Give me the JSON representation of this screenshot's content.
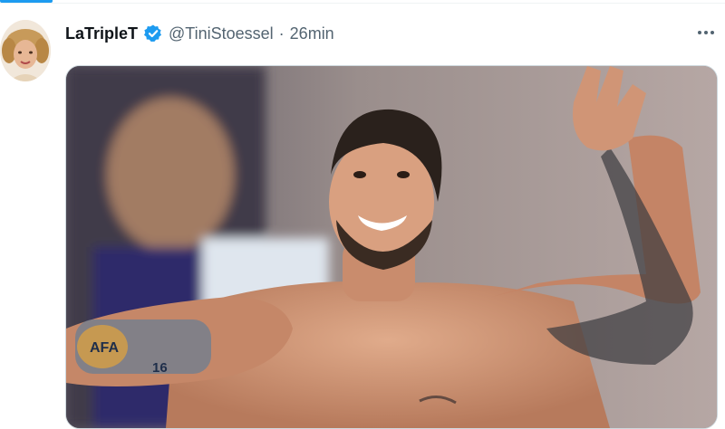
{
  "tweet": {
    "display_name": "LaTripleT",
    "handle": "@TiniStoessel",
    "separator": "·",
    "time": "26min",
    "verified": true
  },
  "icons": {
    "verified": "verified-badge-icon",
    "more": "more-options-icon"
  },
  "media": {
    "tattoo_text": "AFA",
    "tattoo_number": "16"
  },
  "colors": {
    "accent": "#1d9bf0",
    "text_primary": "#0f1419",
    "text_secondary": "#536471",
    "border": "#cfd9de"
  }
}
